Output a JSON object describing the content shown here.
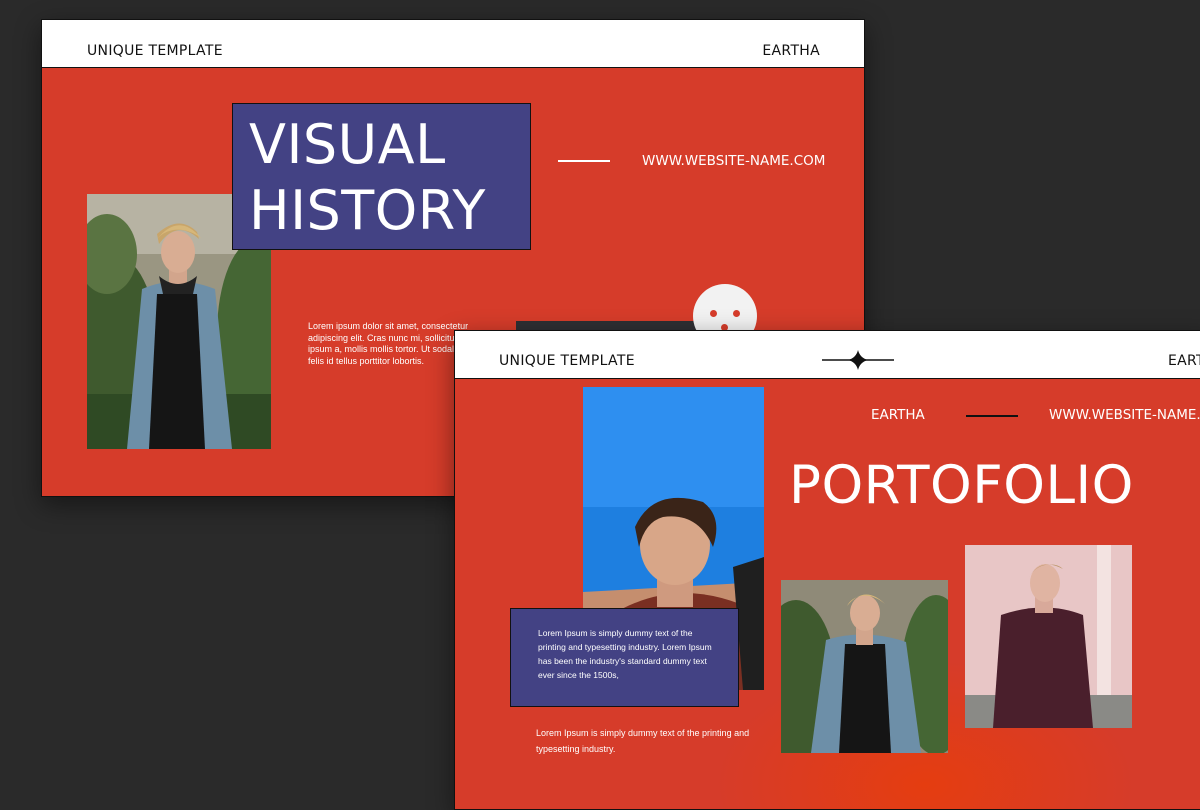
{
  "slide1": {
    "header_left": "UNIQUE TEMPLATE",
    "header_right": "EARTHA",
    "title_line1": "VISUAL",
    "title_line2": "HISTORY",
    "website": "WWW.WEBSITE-NAME.COM",
    "body_text": "Lorem ipsum dolor sit amet, consectetur adipiscing elit. Cras nunc mi, sollicitudin ipsum a, mollis mollis tortor. Ut sodales felis id tellus porttitor lobortis."
  },
  "slide2": {
    "header_left": "UNIQUE TEMPLATE",
    "header_right": "EARTHA",
    "brand": "EARTHA",
    "website": "WWW.WEBSITE-NAME.COM",
    "title": "PORTOFOLIO",
    "box_text": "Lorem Ipsum is simply dummy text of the printing and typesetting industry. Lorem Ipsum has been the industry's standard dummy text ever since the 1500s,",
    "bottom_text": "Lorem Ipsum is simply dummy text of the printing and typesetting industry."
  },
  "colors": {
    "slide_red": "#d63c2a",
    "title_box_purple": "#434284",
    "page_background": "#2a2a2a",
    "header_white": "#ffffff",
    "text_dark": "#111111"
  },
  "icons": {
    "slide2_header_ornament": "four-point-star-icon",
    "smiley": "smiley-face-icon"
  }
}
